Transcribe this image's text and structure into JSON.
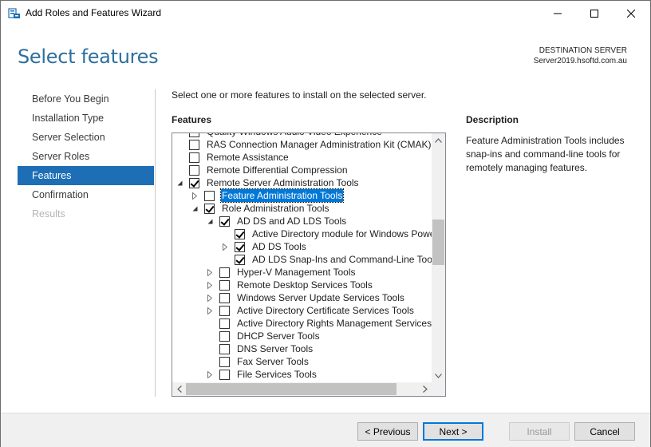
{
  "window": {
    "title": "Add Roles and Features Wizard"
  },
  "header": {
    "page_title": "Select features",
    "destination_label": "DESTINATION SERVER",
    "destination_server": "Server2019.hsoftd.com.au"
  },
  "nav": {
    "items": [
      {
        "label": "Before You Begin",
        "state": "normal"
      },
      {
        "label": "Installation Type",
        "state": "normal"
      },
      {
        "label": "Server Selection",
        "state": "normal"
      },
      {
        "label": "Server Roles",
        "state": "normal"
      },
      {
        "label": "Features",
        "state": "active"
      },
      {
        "label": "Confirmation",
        "state": "normal"
      },
      {
        "label": "Results",
        "state": "disabled"
      }
    ]
  },
  "main": {
    "instruction": "Select one or more features to install on the selected server.",
    "features_heading": "Features",
    "description_heading": "Description",
    "description_text": "Feature Administration Tools includes snap-ins and command-line tools for remotely managing features."
  },
  "tree": [
    {
      "label": "Quality Windows Audio Video Experience",
      "level": 0,
      "expander": "none",
      "checked": false,
      "selected": false
    },
    {
      "label": "RAS Connection Manager Administration Kit (CMAK)",
      "level": 0,
      "expander": "none",
      "checked": false,
      "selected": false
    },
    {
      "label": "Remote Assistance",
      "level": 0,
      "expander": "none",
      "checked": false,
      "selected": false
    },
    {
      "label": "Remote Differential Compression",
      "level": 0,
      "expander": "none",
      "checked": false,
      "selected": false
    },
    {
      "label": "Remote Server Administration Tools",
      "level": 0,
      "expander": "expanded",
      "checked": true,
      "selected": false
    },
    {
      "label": "Feature Administration Tools",
      "level": 1,
      "expander": "collapsed",
      "checked": false,
      "selected": true
    },
    {
      "label": "Role Administration Tools",
      "level": 1,
      "expander": "expanded",
      "checked": true,
      "selected": false
    },
    {
      "label": "AD DS and AD LDS Tools",
      "level": 2,
      "expander": "expanded",
      "checked": true,
      "selected": false
    },
    {
      "label": "Active Directory module for Windows PowerShell",
      "level": 3,
      "expander": "none",
      "checked": true,
      "selected": false
    },
    {
      "label": "AD DS Tools",
      "level": 3,
      "expander": "collapsed",
      "checked": true,
      "selected": false
    },
    {
      "label": "AD LDS Snap-Ins and Command-Line Tools",
      "level": 3,
      "expander": "none",
      "checked": true,
      "selected": false
    },
    {
      "label": "Hyper-V Management Tools",
      "level": 2,
      "expander": "collapsed",
      "checked": false,
      "selected": false
    },
    {
      "label": "Remote Desktop Services Tools",
      "level": 2,
      "expander": "collapsed",
      "checked": false,
      "selected": false
    },
    {
      "label": "Windows Server Update Services Tools",
      "level": 2,
      "expander": "collapsed",
      "checked": false,
      "selected": false
    },
    {
      "label": "Active Directory Certificate Services Tools",
      "level": 2,
      "expander": "collapsed",
      "checked": false,
      "selected": false
    },
    {
      "label": "Active Directory Rights Management Services Tools",
      "level": 2,
      "expander": "none",
      "checked": false,
      "selected": false
    },
    {
      "label": "DHCP Server Tools",
      "level": 2,
      "expander": "none",
      "checked": false,
      "selected": false
    },
    {
      "label": "DNS Server Tools",
      "level": 2,
      "expander": "none",
      "checked": false,
      "selected": false
    },
    {
      "label": "Fax Server Tools",
      "level": 2,
      "expander": "none",
      "checked": false,
      "selected": false
    },
    {
      "label": "File Services Tools",
      "level": 2,
      "expander": "collapsed",
      "checked": false,
      "selected": false
    }
  ],
  "footer": {
    "previous_label": "< Previous",
    "next_label": "Next >",
    "install_label": "Install",
    "cancel_label": "Cancel"
  },
  "colors": {
    "title_blue": "#2e6f9e",
    "nav_active_bg": "#1d6eb5",
    "selection_bg": "#0078d7"
  }
}
